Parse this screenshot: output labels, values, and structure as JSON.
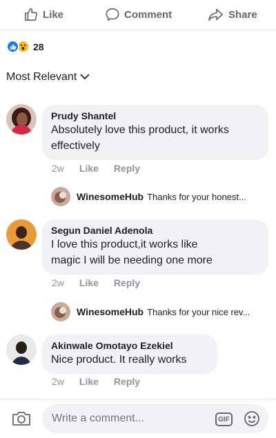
{
  "actions": {
    "like": "Like",
    "comment": "Comment",
    "share": "Share"
  },
  "reactions": {
    "count": "28",
    "types": [
      "like-icon",
      "wow-icon"
    ]
  },
  "sort": {
    "label": "Most Relevant"
  },
  "comments": [
    {
      "author": "Prudy Shantel",
      "text_lines": [
        "Absolutely love this product, it works",
        "effectively"
      ],
      "time": "2w",
      "like": "Like",
      "reply": "Reply"
    },
    {
      "author": "Segun Daniel Adenola",
      "text_lines": [
        "I love this product,it works  like",
        "magic I will be needing one more"
      ],
      "time": "2w",
      "like": "Like",
      "reply": "Reply"
    },
    {
      "author": "Akinwale Omotayo Ezekiel",
      "text_lines": [
        "Nice product. It really works"
      ],
      "time": "2w",
      "like": "Like",
      "reply": "Reply"
    }
  ],
  "replies": [
    {
      "author": "WinesomeHub",
      "text": "Thanks for your honest..."
    },
    {
      "author": "WinesomeHub",
      "text": "Thanks for your nice rev..."
    }
  ],
  "composer": {
    "placeholder": "Write a comment...",
    "gif_label": "GIF"
  },
  "colors": {
    "like_blue": "#1877f2",
    "wow_yellow": "#f7b928",
    "bubble_bg": "#f0f2f5",
    "meta_gray": "#90949c"
  }
}
